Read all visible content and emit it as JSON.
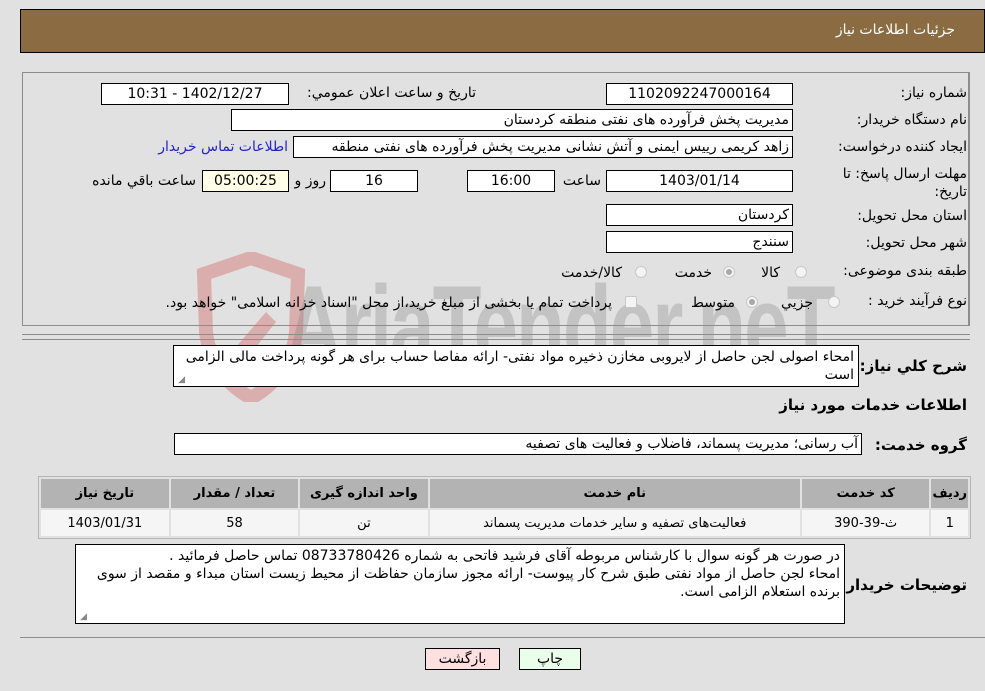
{
  "header": {
    "title": "جزئیات اطلاعات نیاز"
  },
  "form": {
    "need_number": {
      "label": "شماره نیاز:",
      "value": "1102092247000164"
    },
    "announce_datetime": {
      "label": "تاریخ و ساعت اعلان عمومي:",
      "value": "1402/12/27 - 10:31"
    },
    "buyer_org": {
      "label": "نام دستگاه خریدار:",
      "value": "مدیریت پخش فرآورده های نفتی منطقه کردستان"
    },
    "requester": {
      "label": "ایجاد کننده درخواست:",
      "value": "زاهد کریمی رییس ایمنی و آتش نشانی مدیریت پخش فرآورده های نفتی منطقه",
      "contact_link": "اطلاعات تماس خریدار"
    },
    "deadline": {
      "label": "مهلت ارسال پاسخ: تا تاریخ:",
      "date": "1403/01/14",
      "time_label": "ساعت",
      "time": "16:00",
      "days": "16",
      "days_label": "روز و",
      "remaining": "05:00:25",
      "remaining_label": "ساعت باقي مانده"
    },
    "province": {
      "label": "استان محل تحویل:",
      "value": "کردستان"
    },
    "city": {
      "label": "شهر محل تحویل:",
      "value": "سنندج"
    },
    "category": {
      "label": "طبقه بندی موضوعی:",
      "options": [
        "کالا",
        "خدمت",
        "کالا/خدمت"
      ],
      "selected": "خدمت"
    },
    "purchase_type": {
      "label": "نوع فرآیند خرید :",
      "options": [
        "جزیي",
        "متوسط"
      ],
      "selected": "متوسط",
      "treasury_note": "پرداخت تمام یا بخشی از مبلغ خرید،از محل \"اسناد خزانه اسلامی\" خواهد بود."
    }
  },
  "description": {
    "label": "شرح کلي نیاز:",
    "value": "امحاء اصولی لجن حاصل از لایروبی مخازن ذخیره مواد نفتی- ارائه مفاصا حساب برای هر گونه  پرداخت مالی الزامی  است"
  },
  "services_section": {
    "title": "اطلاعات خدمات مورد نیاز",
    "group_label": "گروه خدمت:",
    "group_value": "آب رسانی؛ مدیریت پسماند، فاضلاب و فعالیت های تصفیه",
    "table": {
      "headers": [
        "ردیف",
        "کد خدمت",
        "نام خدمت",
        "واحد اندازه گیری",
        "تعداد / مقدار",
        "تاریخ نیاز"
      ],
      "rows": [
        [
          "1",
          "ث-39-390",
          "فعالیت‌های تصفیه و سایر خدمات مدیریت پسماند",
          "تن",
          "58",
          "1403/01/31"
        ]
      ]
    }
  },
  "buyer_notes": {
    "label": "توضیحات خریدار:",
    "lines": [
      "در صورت هر گونه سوال با کارشناس مربوطه آقای فرشید فاتحی به شماره 08733780426 تماس حاصل فرمائید .",
      "امحاء لجن  حاصل از مواد نفتی طبق شرح کار پیوست- ارائه مجوز سازمان حفاظت از محیط زیست استان مبداء و مقصد از سوی برنده استعلام الزامی است."
    ]
  },
  "buttons": {
    "print": "چاپ",
    "back": "بازگشت"
  },
  "watermark": {
    "text": "AriaTender.neT"
  },
  "colors": {
    "header_bg": "#8b6c42",
    "print_bg": "#eaffea",
    "back_bg": "#ffe0e0",
    "link": "#2323c8"
  }
}
